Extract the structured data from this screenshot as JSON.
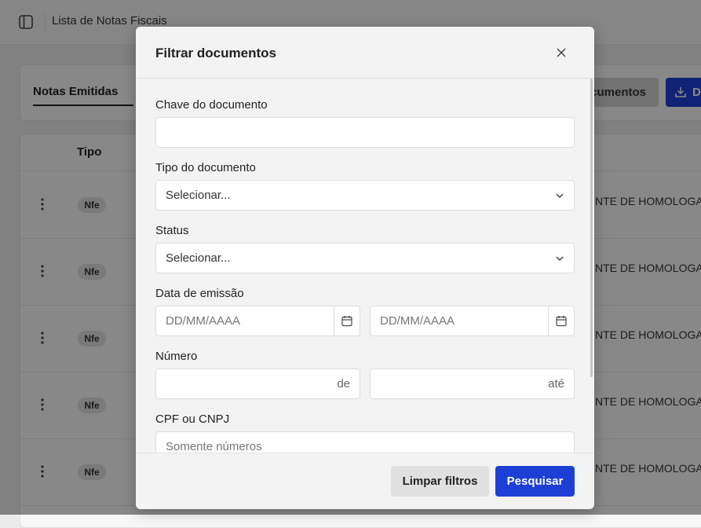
{
  "topbar": {
    "title": "Lista de Notas Fiscais",
    "toggle_icon": "sidebar-toggle-icon"
  },
  "tabs": {
    "active": "Notas Emitidas"
  },
  "actions": {
    "documents_label": "cumentos",
    "download_label": "D"
  },
  "table": {
    "header_tipo": "Tipo",
    "rows": [
      {
        "tipo": "Nfe",
        "info": "NTE DE HOMOLOGA"
      },
      {
        "tipo": "Nfe",
        "info": "NTE DE HOMOLOGA"
      },
      {
        "tipo": "Nfe",
        "info": "NTE DE HOMOLOGA"
      },
      {
        "tipo": "Nfe",
        "info": "NTE DE HOMOLOGA"
      },
      {
        "tipo": "Nfe",
        "info": "NTE DE HOMOLOGA"
      }
    ]
  },
  "modal": {
    "title": "Filtrar documentos",
    "fields": {
      "chave": {
        "label": "Chave do documento",
        "value": ""
      },
      "tipo": {
        "label": "Tipo do documento",
        "value": "Selecionar..."
      },
      "status": {
        "label": "Status",
        "value": "Selecionar..."
      },
      "data": {
        "label": "Data de emissão",
        "start_placeholder": "DD/MM/AAAA",
        "end_placeholder": "DD/MM/AAAA"
      },
      "numero": {
        "label": "Número",
        "from_suffix": "de",
        "to_suffix": "até"
      },
      "cpf": {
        "label": "CPF ou CNPJ",
        "placeholder": "Somente números"
      }
    },
    "footer": {
      "clear_label": "Limpar filtros",
      "search_label": "Pesquisar"
    }
  },
  "colors": {
    "primary": "#1d3fd6",
    "overlay": "rgba(0,0,0,0.45)"
  }
}
